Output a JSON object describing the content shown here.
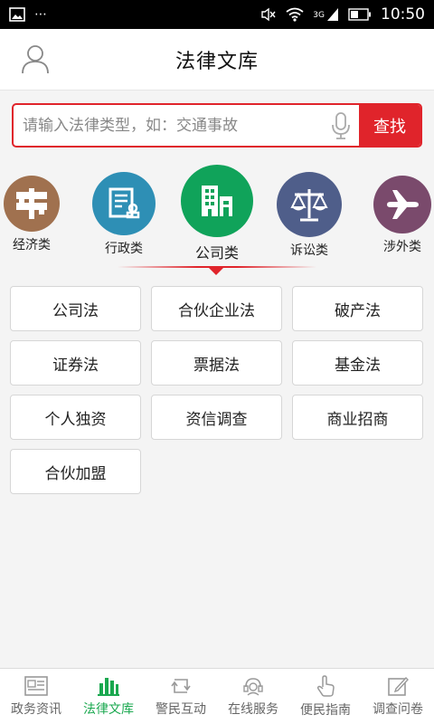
{
  "status": {
    "time": "10:50",
    "network": "3G"
  },
  "header": {
    "title": "法律文库"
  },
  "search": {
    "placeholder": "请输入法律类型，如：交通事故",
    "button": "查找"
  },
  "categories": [
    {
      "label": "经济类",
      "color": "#a0714f"
    },
    {
      "label": "行政类",
      "color": "#2e8fb5"
    },
    {
      "label": "公司类",
      "color": "#10a35a"
    },
    {
      "label": "诉讼类",
      "color": "#4f5e8a"
    },
    {
      "label": "涉外类",
      "color": "#7a4a6c"
    }
  ],
  "laws": [
    "公司法",
    "合伙企业法",
    "破产法",
    "证券法",
    "票据法",
    "基金法",
    "个人独资",
    "资信调查",
    "商业招商",
    "合伙加盟"
  ],
  "tabs": [
    "政务资讯",
    "法律文库",
    "警民互动",
    "在线服务",
    "便民指南",
    "调查问卷"
  ],
  "colors": {
    "accent": "#e0242b",
    "active_tab": "#1aa84f"
  }
}
